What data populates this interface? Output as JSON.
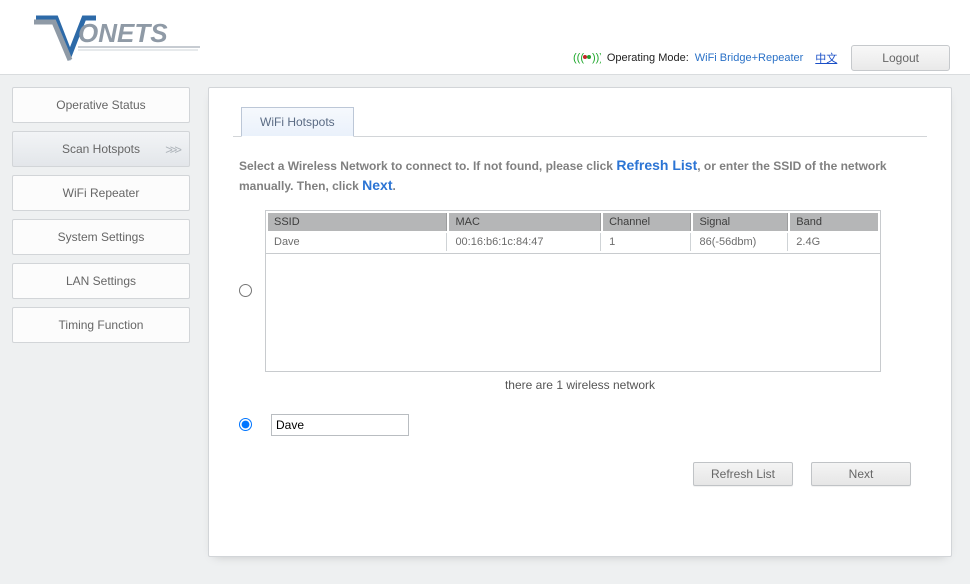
{
  "header": {
    "brand": "VONETS",
    "op_mode_label": "Operating Mode:",
    "op_mode_value": "WiFi Bridge+Repeater",
    "lang_link": "中文",
    "logout_label": "Logout"
  },
  "sidebar": {
    "items": [
      {
        "label": "Operative Status"
      },
      {
        "label": "Scan Hotspots",
        "active": true
      },
      {
        "label": "WiFi Repeater"
      },
      {
        "label": "System Settings"
      },
      {
        "label": "LAN Settings"
      },
      {
        "label": "Timing Function"
      }
    ]
  },
  "main": {
    "tab_label": "WiFi Hotspots",
    "instr_pre": "Select a Wireless Network to connect to. If not found, please click ",
    "instr_refresh": "Refresh List",
    "instr_mid": ", or enter the SSID of the network manually. Then, click ",
    "instr_next": "Next",
    "instr_post": ".",
    "columns": {
      "ssid": "SSID",
      "mac": "MAC",
      "channel": "Channel",
      "signal": "Signal",
      "band": "Band"
    },
    "rows": [
      {
        "ssid": "Dave",
        "mac": "00:16:b6:1c:84:47",
        "channel": "1",
        "signal": "86(-56dbm)",
        "band": "2.4G"
      }
    ],
    "footer_note": "there are 1 wireless network",
    "manual_ssid_value": "Dave",
    "refresh_label": "Refresh List",
    "next_label": "Next"
  }
}
